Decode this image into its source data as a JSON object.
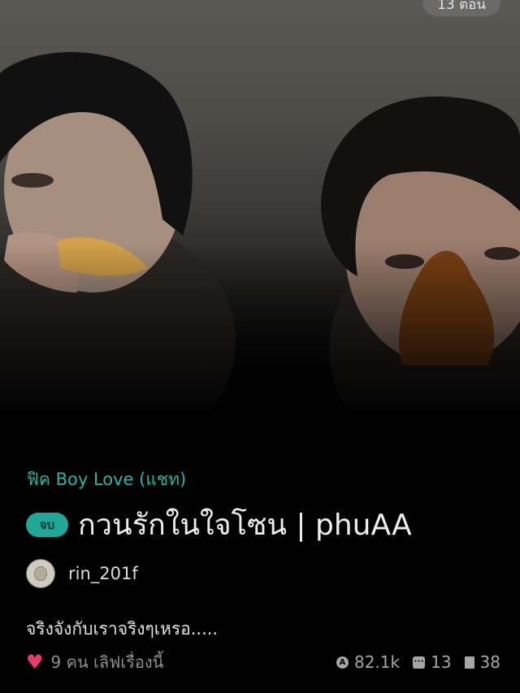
{
  "header": {
    "episode_count": "13 ตอน"
  },
  "story": {
    "category": "ฟิค Boy Love (แชท)",
    "status": "จบ",
    "title": "กวนรักในใจโซน | phuAA",
    "synopsis": "จริงจังกับเราจริงๆเหรอ....."
  },
  "author": {
    "name": "rin_201f"
  },
  "stats": {
    "likes_text": "9 คน เลิฟเรื่องนี้",
    "views": "82.1k",
    "comments": "13",
    "chapters": "38"
  },
  "colors": {
    "accent": "#2ab5a4",
    "status_pill": "#21a797",
    "heart": "#e63b6e"
  }
}
